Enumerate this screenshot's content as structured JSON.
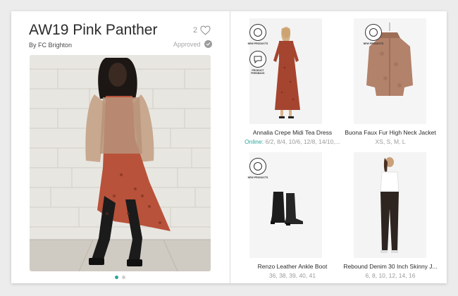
{
  "header": {
    "title": "AW19 Pink Panther",
    "byline": "By FC Brighton",
    "likes_count": "2",
    "status": "Approved"
  },
  "carousel": {
    "current": 1,
    "total": 2
  },
  "badges": {
    "new_products": "NEW PRODUCTS",
    "product_feedback": "PRODUCT FEEDBACK"
  },
  "products": [
    {
      "name": "Annalia Crepe Midi Tea Dress",
      "availability_label": "Online:",
      "sizes": "6/2, 8/4, 10/6, 12/8, 14/10,..."
    },
    {
      "name": "Buona Faux Fur High Neck Jacket",
      "sizes": "XS, S, M, L"
    },
    {
      "name": "Renzo Leather Ankle Boot",
      "sizes": "36, 38, 39, 40, 41"
    },
    {
      "name": "Rebound Denim 30 Inch Skinny J...",
      "sizes": "6, 8, 10, 12, 14, 16"
    }
  ],
  "colors": {
    "accent": "#2aa59a",
    "muted_text": "#9a9a9a",
    "divider": "#dcdcdc"
  },
  "icons": [
    "heart-icon",
    "check-icon",
    "new-products-badge-icon",
    "product-feedback-badge-icon"
  ]
}
